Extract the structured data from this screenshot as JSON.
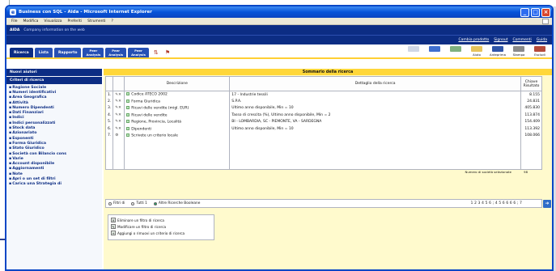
{
  "window": {
    "title": "Business con SQL - Aida - Microsoft Internet Explorer",
    "menu": [
      "File",
      "Modifica",
      "Visualizza",
      "Preferiti",
      "Strumenti",
      "?"
    ]
  },
  "brand": {
    "logo": "AIDA",
    "tagline": "Company information on the web"
  },
  "toplinks": [
    "Cambia prodotto",
    "Signout",
    "Commenti",
    "Guida"
  ],
  "tabs": {
    "t1": "Ricerca",
    "t2": "Lista",
    "t3": "Rapporto",
    "s1a": "Peer",
    "s1b": "Analysis",
    "s2a": "Peer",
    "s2b": "Analysis",
    "s3a": "Peer",
    "s3b": "Analysis"
  },
  "right_tools": [
    "",
    "",
    "",
    "Aiuto",
    "Anteprima",
    "Stampa",
    "Escludi"
  ],
  "sidebar": {
    "head1": "Nuovi aiutori",
    "head2": "Criteri di ricerca",
    "items": [
      "Ragione Sociale",
      "Numeri identificativi",
      "Area Geografica",
      "Attività",
      "Numero Dipendenti",
      "Dati Finanziari",
      "Indici",
      "Indici personalizzati",
      "Stock data",
      "Azionariato",
      "Esponenti",
      "Forma Giuridica",
      "Stato Giuridico",
      "Società con Bilancio cons",
      "Varie",
      "Account disponibile",
      "Aggiornamenti",
      "Note",
      "Apri o un set di filtri",
      "Carica una Strategia di"
    ]
  },
  "main": {
    "table_title": "Sommario della ricerca",
    "col_desc": "Descrizione",
    "col_detail": "Dettaglio della ricerca",
    "col_count": "Chiave Risultato",
    "rows": [
      {
        "n": "1.",
        "desc": "Codice ATECO 2002",
        "detail": "17 - Industrie tessili",
        "count": "8.155"
      },
      {
        "n": "2.",
        "desc": "Forma Giuridica",
        "detail": "S.P.A.",
        "count": "24.831"
      },
      {
        "n": "3.",
        "desc": "Ricavi delle vendite (migl. EUR)",
        "detail": "Ultimo anno disponibile, Min = 10",
        "count": "405.830"
      },
      {
        "n": "4.",
        "desc": "Ricavi delle vendite",
        "detail": "Tasso di crescita (%), Ultimo anno disponibile, Min = 2",
        "count": "113.874"
      },
      {
        "n": "5.",
        "desc": "Regione, Provincia, Località",
        "detail": "BI - LOMBARDIA, SC - PIEMONTE, VA - SARDEGNA",
        "count": "154.409"
      },
      {
        "n": "6.",
        "desc": "Dipendenti",
        "detail": "Ultimo anno disponibile, Min = 10",
        "count": "113.392"
      },
      {
        "n": "7.",
        "desc": "Scrivete un criterio locale",
        "detail": "",
        "count": "108.066"
      }
    ],
    "sum_label": "Numero di società selezionate",
    "sum_value": "98",
    "filters": {
      "o1": "Filtri di",
      "o2": "Tutti 1",
      "o3": "Altre Ricerche Booleane"
    },
    "pages": "1 2 3 4 5 6 ; 4 5 6 6 6 6 ; 7",
    "go": "",
    "actions": [
      "Eliminare un filtro di ricerca",
      "Modificare un filtro di ricerca",
      "Aggiungi o rimuovi un criterio di ricerca"
    ]
  }
}
